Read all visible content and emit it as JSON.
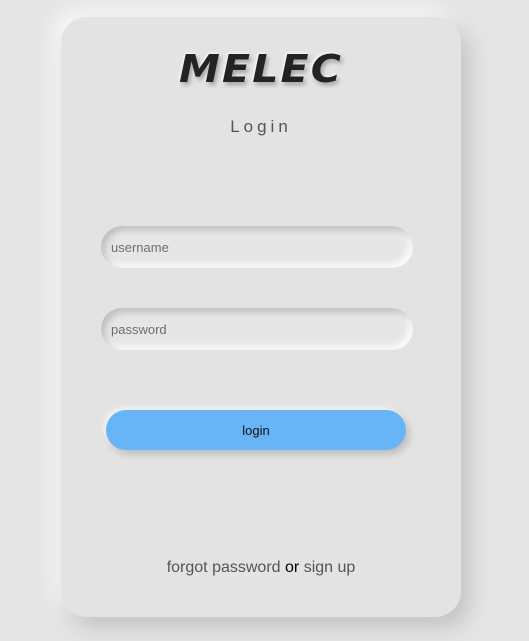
{
  "logo": {
    "text": "MELEC"
  },
  "form": {
    "title": "Login",
    "username_placeholder": "username",
    "password_placeholder": "password",
    "login_label": "login"
  },
  "footer": {
    "forgot_label": "forgot password",
    "or_text": "or",
    "signup_label": "sign up"
  },
  "colors": {
    "background": "#e5e5e5",
    "card": "#e3e3e3",
    "button": "#69b3f7",
    "logo": "#232323"
  }
}
